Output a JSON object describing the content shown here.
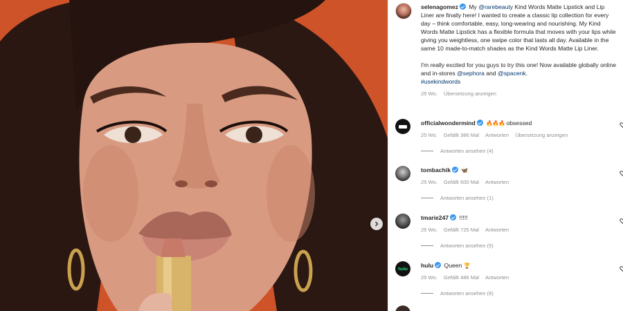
{
  "post": {
    "author": "selenagomez",
    "caption_before_link": " My ",
    "caption_mention": "@rarebeauty",
    "caption_after_link": " Kind Words Matte Lipstick and Lip Liner are finally here! I wanted to create a classic lip collection for every day – think comfortable, easy, long-wearing and nourishing. My Kind Words Matte Lipstick has a flexible formula that moves with your lips while giving you weightless, one swipe color that lasts all day. Available in the same 10 made-to-match shades as the Kind Words Matte Lip Liner.",
    "caption_p2_start": "I'm really excited for you guys to try this one! Now available globally online and in-stores ",
    "mention_sephora": "@sephora",
    "and_text": " and ",
    "mention_spacenk": "@spacenk",
    "period": ".",
    "hashtag": "#usekindwords",
    "time": "25 Wo.",
    "translate": "Übersetzung anzeigen"
  },
  "comments": [
    {
      "username": "officialwondermind",
      "text": "obsessed",
      "emoji": "🔥🔥🔥",
      "time": "25 Wo.",
      "likes": "Gefällt 386 Mal",
      "reply": "Antworten",
      "translate": "Übersetzung anzeigen",
      "view_replies": "Antworten ansehen (4)"
    },
    {
      "username": "tombachik",
      "text": "",
      "emoji": "🦋",
      "time": "25 Wo.",
      "likes": "Gefällt 600 Mal",
      "reply": "Antworten",
      "view_replies": "Antworten ansehen (1)"
    },
    {
      "username": "tmarie247",
      "text": "!!!!!",
      "time": "25 Wo.",
      "likes": "Gefällt 725 Mal",
      "reply": "Antworten",
      "view_replies": "Antworten ansehen (5)"
    },
    {
      "username": "hulu",
      "text": "Queen",
      "emoji": "🏆",
      "avatar_text": "hulu",
      "time": "25 Wo.",
      "likes": "Gefällt 486 Mal",
      "reply": "Antworten",
      "view_replies": "Antworten ansehen (6)"
    }
  ],
  "colors": {
    "verified": "#3897f0",
    "link": "#00376b",
    "muted": "#8e8e8e",
    "hulu_green": "#1ce783"
  },
  "icons": {
    "next": "chevron-right-icon",
    "like": "heart-icon",
    "verified": "verified-badge-icon"
  }
}
